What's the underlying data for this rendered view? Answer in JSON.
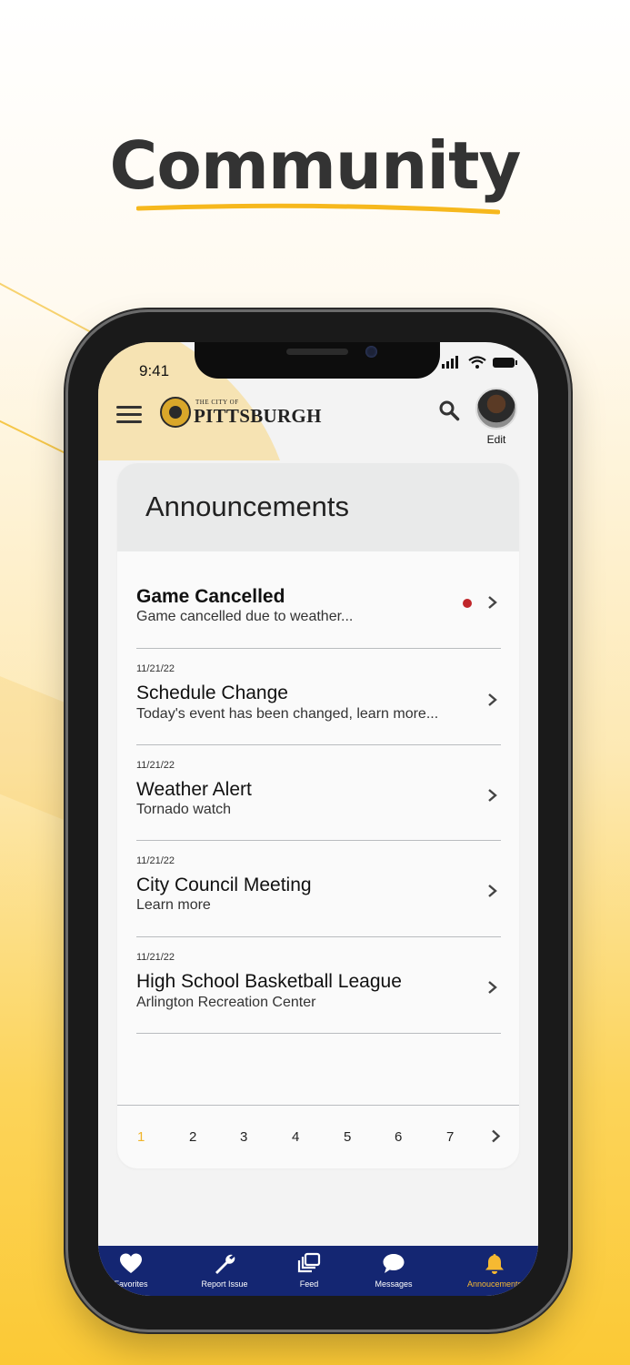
{
  "headline": "Community",
  "colors": {
    "accent": "#f0b429",
    "tabbar": "#142672",
    "unread_dot": "#c0262a"
  },
  "status_bar": {
    "time": "9:41"
  },
  "app_header": {
    "menu_icon": "hamburger-icon",
    "logo_small": "THE CITY OF",
    "logo_big": "PITTSBURGH",
    "search_icon": "search-icon",
    "edit_label": "Edit"
  },
  "announcements": {
    "title": "Announcements",
    "items": [
      {
        "date": "",
        "title": "Game Cancelled",
        "subtitle": "Game cancelled due to weather...",
        "unread": true
      },
      {
        "date": "11/21/22",
        "title": "Schedule Change",
        "subtitle": "Today's event has been changed, learn more...",
        "unread": false
      },
      {
        "date": "11/21/22",
        "title": "Weather Alert",
        "subtitle": "Tornado watch",
        "unread": false
      },
      {
        "date": "11/21/22",
        "title": "City Council Meeting",
        "subtitle": "Learn more",
        "unread": false
      },
      {
        "date": "11/21/22",
        "title": "High School Basketball League",
        "subtitle": "Arlington Recreation Center",
        "unread": false
      }
    ]
  },
  "pagination": {
    "pages": [
      "1",
      "2",
      "3",
      "4",
      "5",
      "6",
      "7"
    ],
    "current": "1"
  },
  "tabbar": {
    "tabs": [
      {
        "label": "Favorites",
        "icon": "heart-icon",
        "active": false
      },
      {
        "label": "Report Issue",
        "icon": "wrench-icon",
        "active": false
      },
      {
        "label": "Feed",
        "icon": "feed-icon",
        "active": false
      },
      {
        "label": "Messages",
        "icon": "chat-bubble-icon",
        "active": false
      },
      {
        "label": "Annoucements",
        "icon": "bell-icon",
        "active": true
      }
    ]
  }
}
